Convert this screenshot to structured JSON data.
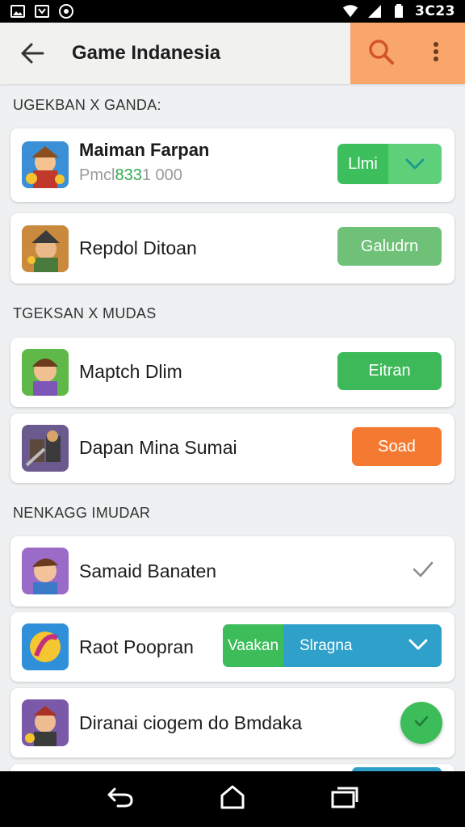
{
  "app_bar": {
    "title": "Game Indanesia",
    "back_icon": "arrow-left-icon",
    "search_icon": "search-icon",
    "more_icon": "more-vertical-icon",
    "accent_color": "#f9a66b"
  },
  "status_bar": {
    "time": "3C23"
  },
  "sections": [
    {
      "label": "UGEKBAN X GANDA:"
    },
    {
      "label": "TGEKSAN X MUDAS"
    },
    {
      "label": "NENKAGG IMUDAR"
    }
  ],
  "items": [
    {
      "name": "Maiman Farpan",
      "sub_prefix": "Pmcl",
      "sub_highlight": "833",
      "sub_suffix": "1 000",
      "button_label": "Llmi",
      "button_color": "#3cbf5c"
    },
    {
      "name": "Repdol Ditoan",
      "button_label": "Galudrn",
      "button_color": "#6ec177"
    },
    {
      "name": "Maptch Dlim",
      "button_label": "Eitran",
      "button_color": "#3db95a"
    },
    {
      "name": "Dapan Mina Sumai",
      "button_label": "Soad",
      "button_color": "#f37a30"
    },
    {
      "name": "Samaid Banaten"
    },
    {
      "name": "Raot Poopran",
      "button_left_label": "Vaakan",
      "button_right_label": "Slragna",
      "left_color": "#3dbd5a",
      "right_color": "#2ea0c9"
    },
    {
      "name": "Diranai ciogem do Bmdaka",
      "fab_color": "#3dbd5a"
    }
  ]
}
